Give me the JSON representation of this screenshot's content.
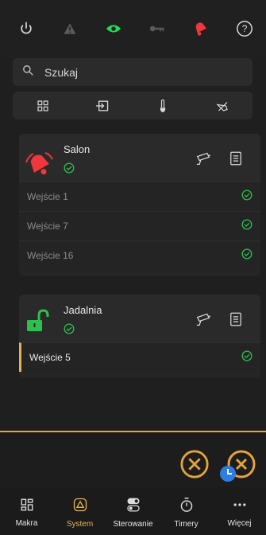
{
  "colors": {
    "accent": "#e2a43b",
    "alarm_red": "#f0373d",
    "ok_green": "#2ebf4f",
    "eye_green": "#1fdc57",
    "icon_gray": "#dcdcdc",
    "muted": "#6f6f6f"
  },
  "topbar": {
    "icons": [
      "power-icon",
      "warning-icon",
      "eye-icon",
      "key-icon",
      "alarm-bell-icon",
      "help-icon"
    ]
  },
  "search": {
    "placeholder": "Szukaj"
  },
  "filters": {
    "icons": [
      "grid-icon",
      "entry-icon",
      "thermometer-icon",
      "sensor-icon"
    ]
  },
  "groups": [
    {
      "name": "Salon",
      "state": "alarm",
      "rows": [
        {
          "label": "Wejście 1",
          "status": "ok"
        },
        {
          "label": "Wejście 7",
          "status": "ok"
        },
        {
          "label": "Wejście 16",
          "status": "ok"
        }
      ]
    },
    {
      "name": "Jadalnia",
      "state": "unlocked",
      "rows": [
        {
          "label": "Wejście 5",
          "status": "ok",
          "selected": true
        }
      ]
    }
  ],
  "nav": [
    {
      "label": "Makra",
      "icon": "macros-icon"
    },
    {
      "label": "System",
      "icon": "system-icon",
      "active": true
    },
    {
      "label": "Sterowanie",
      "icon": "toggle-icon"
    },
    {
      "label": "Timery",
      "icon": "timer-icon"
    },
    {
      "label": "Więcej",
      "icon": "more-icon"
    }
  ]
}
